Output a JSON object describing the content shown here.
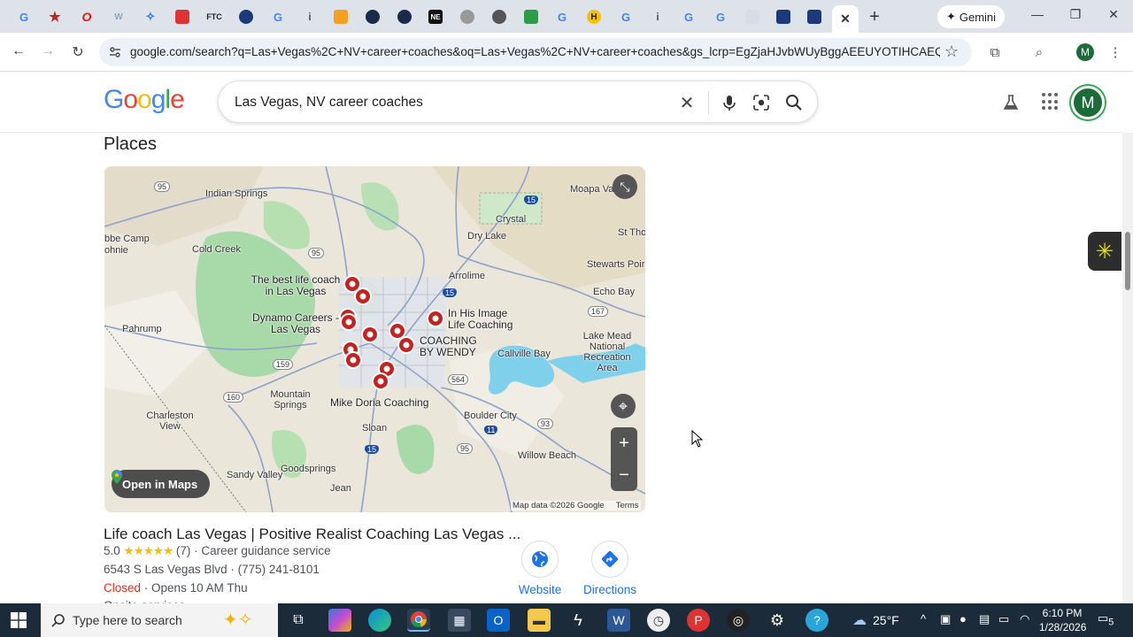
{
  "browser": {
    "tabs_count": 27,
    "gemini_label": "Gemini",
    "url": "google.com/search?q=Las+Vegas%2C+NV+career+coaches&oq=Las+Vegas%2C+NV+career+coaches&gs_lcrp=EgZjaHJvbWUyBggAEEUYOTIHCAEQIRigA...",
    "profile_initial": "M"
  },
  "google": {
    "logo": "Google",
    "query": "Las Vegas, NV career coaches",
    "avatar_initial": "M"
  },
  "places": {
    "heading": "Places",
    "open_in_maps": "Open in Maps",
    "map_attribution": "Map data ©2026 Google",
    "terms": "Terms",
    "map_labels": {
      "indian_springs": "Indian Springs",
      "moapa": "Moapa Val",
      "crystal": "Crystal",
      "dry_lake": "Dry Lake",
      "st_thom": "St Thom",
      "bbe_camp": "bbe Camp",
      "ohnie": "ohnie",
      "cold_creek": "Cold Creek",
      "stewarts": "Stewarts Poir",
      "arrolime": "Arrolime",
      "echo_bay": "Echo Bay",
      "pahrump": "Pahrump",
      "lake_mead": "Lake Mead National Recreation Area",
      "callville": "Callville Bay",
      "mountain_springs": "Mountain Springs",
      "charleston": "Charleston View",
      "boulder_city": "Boulder City",
      "sloan": "Sloan",
      "willow_beach": "Willow Beach",
      "goodsprings": "Goodsprings",
      "sandy_valley": "Sandy Valley",
      "jean": "Jean",
      "hwy_95a": "95",
      "hwy_15a": "15",
      "hwy_95b": "95",
      "hwy_15b": "15",
      "hwy_167": "167",
      "hwy_159": "159",
      "hwy_564": "564",
      "hwy_160": "160",
      "hwy_93": "93",
      "hwy_11": "11",
      "hwy_15c": "15",
      "hwy_95c": "95"
    },
    "pins": [
      {
        "label": "The best life coach in Las Vegas"
      },
      {
        "label": "Dynamo Careers - Las Vegas"
      },
      {
        "label": "In His Image Life Coaching"
      },
      {
        "label": "COACHING BY WENDY"
      },
      {
        "label": "Mike Doria Coaching"
      }
    ],
    "result": {
      "title": "Life coach Las Vegas | Positive Realist Coaching Las Vegas ...",
      "rating": "5.0",
      "stars": "★★★★★",
      "reviews": "(7)",
      "category": "· Career guidance service",
      "address": "6543 S Las Vegas Blvd · (775) 241-8101",
      "status": "Closed",
      "hours": "· Opens 10 AM Thu",
      "extra": "Onsite services",
      "website_label": "Website",
      "directions_label": "Directions"
    }
  },
  "taskbar": {
    "search_placeholder": "Type here to search",
    "weather": "25°F",
    "time": "6:10 PM",
    "date": "1/28/2026",
    "notif_count": "5"
  },
  "colors": {
    "accent": "#1a73e8",
    "closed": "#d93025",
    "pin": "#c5221f"
  }
}
